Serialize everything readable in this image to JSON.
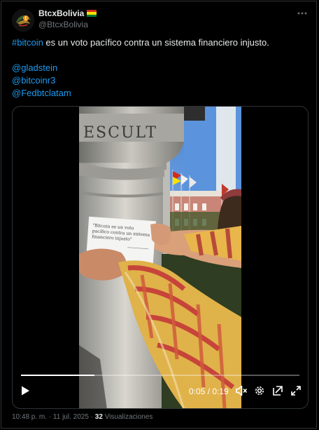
{
  "author": {
    "name": "BtcxBolivia",
    "handle": "@BtcxBolivia",
    "flag_colors": [
      "#d52b1e",
      "#f9e300",
      "#007934"
    ]
  },
  "tweet": {
    "hashtag": "#bitcoin",
    "text_rest": " es un voto pacífico contra un sistema financiero injusto.",
    "mentions": [
      "@gladstein",
      "@bitcoinr3",
      "@Fedbtclatam"
    ]
  },
  "video": {
    "sign_text": "\"Bitcoin es un voto pacífico contra un sistema financiero injusto\"",
    "pillar_text": "ESCULT",
    "time_label": "0:05 / 0:19",
    "progress": 0.263,
    "controls": [
      "play-icon",
      "volume-muted-icon",
      "settings-gear-icon",
      "pop-out-icon",
      "fullscreen-icon"
    ]
  },
  "meta": {
    "time": "10:48 p. m.",
    "separator": " · ",
    "date": "11 jul. 2025",
    "views_count": "32",
    "views_label": "Visualizaciones"
  },
  "colors": {
    "link": "#1d9bf0",
    "secondary_text": "#71767b",
    "primary_text": "#e7e9ea",
    "border": "#2f3336"
  }
}
